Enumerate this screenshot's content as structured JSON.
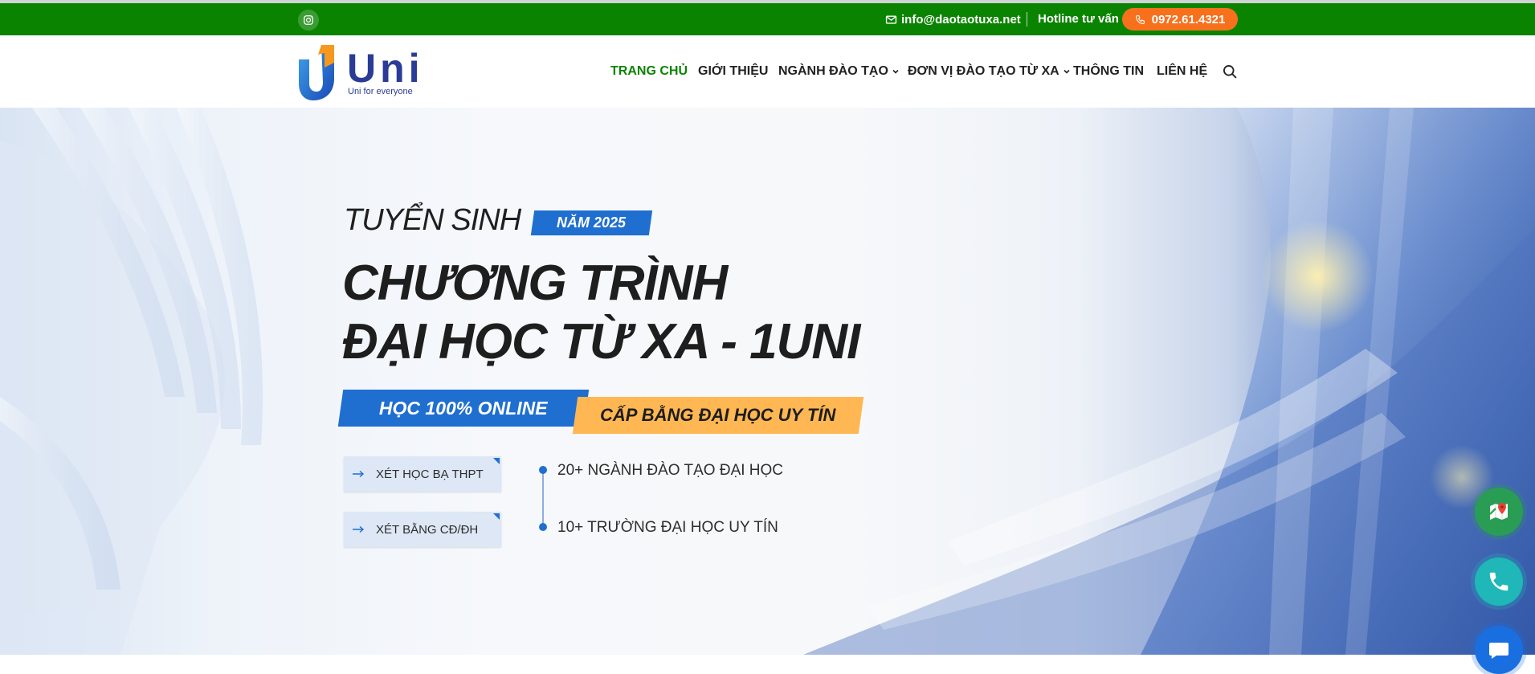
{
  "topbar": {
    "social_icon": "instagram-icon",
    "email_icon": "envelope-icon",
    "email": "info@daotaotuxa.net",
    "hotline_label": "Hotline tư vấn",
    "hotline_number": "0972.61.4321",
    "hotline_icon": "phone-icon"
  },
  "header": {
    "logo_text": "Uni",
    "logo_tagline": "Uni for everyone",
    "nav": [
      {
        "label": "TRANG CHỦ",
        "active": true,
        "dropdown": false
      },
      {
        "label": "GIỚI THIỆU",
        "active": false,
        "dropdown": false
      },
      {
        "label": "NGÀNH ĐÀO TẠO",
        "active": false,
        "dropdown": true
      },
      {
        "label": "ĐƠN VỊ ĐÀO TẠO TỪ XA",
        "active": false,
        "dropdown": true
      },
      {
        "label": "THÔNG TIN",
        "active": false,
        "dropdown": false
      },
      {
        "label": "LIÊN HỆ",
        "active": false,
        "dropdown": false
      }
    ],
    "search_icon": "search-icon"
  },
  "hero": {
    "admission_label": "TUYỂN SINH",
    "year_badge": "NĂM 2025",
    "title_line1": "CHƯƠNG TRÌNH",
    "title_line2": "ĐẠI HỌC TỪ XA - 1UNI",
    "online_tag": "HỌC 100% ONLINE",
    "degree_tag": "CẤP BẰNG ĐẠI HỌC UY TÍN",
    "buttons": [
      {
        "label": "XÉT HỌC BẠ THPT",
        "icon": "arrow-right-icon"
      },
      {
        "label": "XÉT BẰNG CĐ/ĐH",
        "icon": "arrow-right-icon"
      }
    ],
    "stats": [
      "20+ NGÀNH ĐÀO TẠO ĐẠI HỌC",
      "10+ TRƯỜNG ĐẠI HỌC UY TÍN"
    ]
  },
  "floating": {
    "map_icon": "google-maps-icon",
    "phone_icon": "phone-icon",
    "zalo_icon": "zalo-icon"
  },
  "colors": {
    "topbar": "#0a8400",
    "hotline": "#f7701c",
    "brand_blue": "#1f6fd0",
    "accent_orange": "#ffb753",
    "logo_navy": "#2a3c96"
  }
}
